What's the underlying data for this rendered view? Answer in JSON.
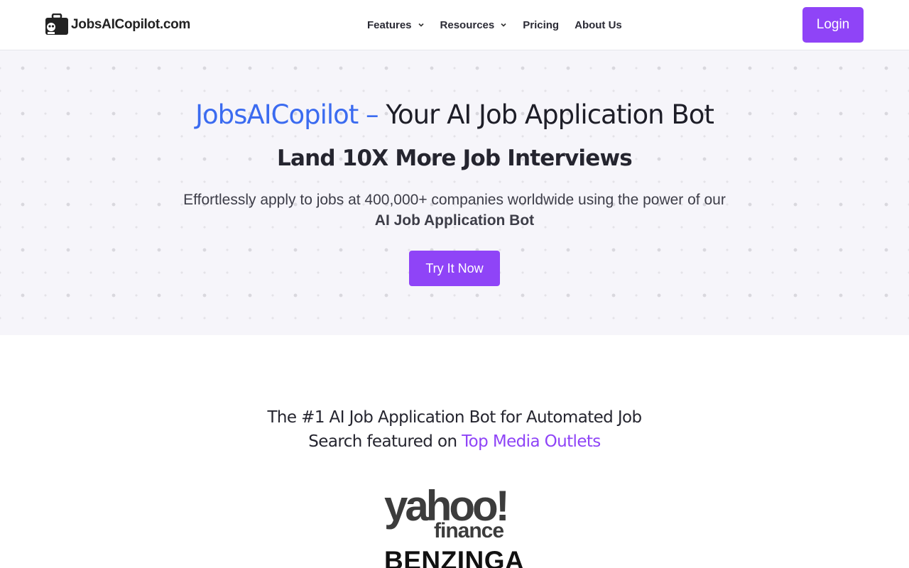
{
  "header": {
    "logo_text": "JobsAICopilot.com",
    "nav": [
      {
        "label": "Features",
        "has_dropdown": true
      },
      {
        "label": "Resources",
        "has_dropdown": true
      },
      {
        "label": "Pricing",
        "has_dropdown": false
      },
      {
        "label": "About Us",
        "has_dropdown": false
      }
    ],
    "login_label": "Login"
  },
  "hero": {
    "title_brand": "JobsAICopilot –",
    "title_rest": " Your AI Job Application Bot",
    "subtitle": "Land 10X More Job Interviews",
    "description": "Effortlessly apply to jobs at 400,000+ companies worldwide using the power of our",
    "description_strong": "AI Job Application Bot",
    "cta_label": "Try It Now"
  },
  "featured": {
    "line1": "The #1 AI Job Application Bot for Automated Job",
    "line2_prefix": "Search featured on ",
    "line2_accent": "Top Media Outlets",
    "logos": [
      {
        "name": "yahoo-finance-logo",
        "text_top": "yahoo!",
        "text_bottom": "finance"
      },
      {
        "name": "benzinga-logo",
        "text": "BENZINGA"
      }
    ]
  },
  "colors": {
    "accent_purple": "#8f44f7",
    "brand_blue": "#3b6bf0",
    "hero_bg": "#f6f5fa",
    "yahoo_gray": "#3c3c3c"
  },
  "icons": {
    "logo": "briefcase-robot-icon",
    "dropdown": "chevron-down-icon"
  }
}
